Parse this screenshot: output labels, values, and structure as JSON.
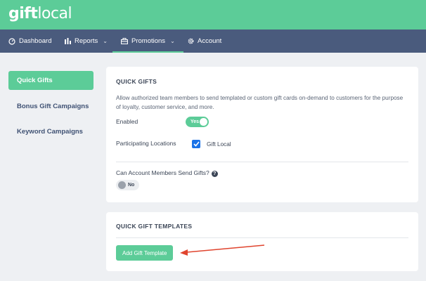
{
  "brand": {
    "logo_bold": "gift",
    "logo_light": "local"
  },
  "nav": {
    "dashboard": {
      "label": "Dashboard",
      "icon": "gauge-icon"
    },
    "reports": {
      "label": "Reports",
      "icon": "bar-chart-icon"
    },
    "promotions": {
      "label": "Promotions",
      "icon": "gift-box-icon"
    },
    "account": {
      "label": "Account",
      "icon": "gear-icon"
    },
    "chevron": "⌄"
  },
  "sidebar": {
    "items": [
      {
        "label": "Quick Gifts",
        "active": true
      },
      {
        "label": "Bonus Gift Campaigns",
        "active": false
      },
      {
        "label": "Keyword Campaigns",
        "active": false
      }
    ]
  },
  "quick_gifts": {
    "title": "QUICK GIFTS",
    "description": "Allow authorized team members to send templated or custom gift cards on-demand to customers for the purpose of loyalty, customer service, and more.",
    "enabled_label": "Enabled",
    "enabled_value": "Yes",
    "locations_label": "Participating Locations",
    "location_name": "Gift Local",
    "location_checked": true,
    "members_label": "Can Account Members Send Gifts?",
    "members_help": "?",
    "members_value": "No"
  },
  "templates": {
    "title": "QUICK GIFT TEMPLATES",
    "add_button": "Add Gift Template"
  },
  "colors": {
    "accent": "#5ccc98",
    "nav_bg": "#4a5b7d",
    "annotation_arrow": "#e0442e"
  }
}
